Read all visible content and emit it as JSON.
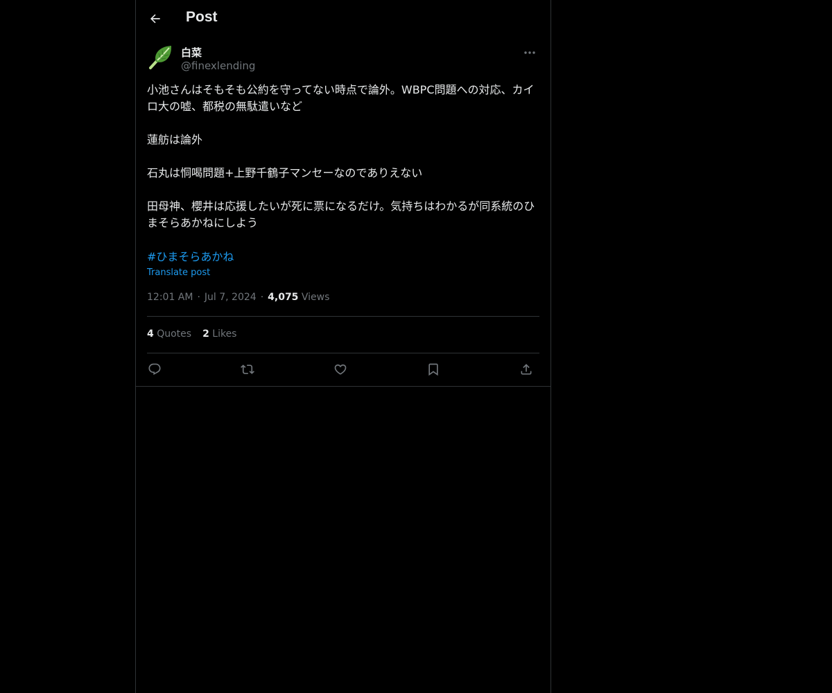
{
  "header": {
    "title": "Post",
    "back_icon": "arrow-left-icon"
  },
  "author": {
    "name": "白菜",
    "handle": "@finexlending",
    "avatar_icon": "leafy-green-icon",
    "more_icon": "more-dots-icon"
  },
  "post": {
    "paragraphs": [
      "小池さんはそもそも公約を守ってない時点で論外。WBPC問題への対応、カイロ大の嘘、都税の無駄遣いなど",
      "蓮舫は論外",
      "石丸は恫喝問題+上野千鶴子マンセーなのでありえない",
      "田母神、櫻井は応援したいが死に票になるだけ。気持ちはわかるが同系統のひまそらあかねにしよう"
    ],
    "hashtag": "#ひまそらあかね",
    "translate_label": "Translate post"
  },
  "meta": {
    "time": "12:01 AM",
    "separator": "·",
    "date": "Jul 7, 2024",
    "views_count": "4,075",
    "views_label": "Views"
  },
  "stats": {
    "quotes_count": "4",
    "quotes_label": "Quotes",
    "likes_count": "2",
    "likes_label": "Likes"
  },
  "actions": {
    "reply_icon": "reply-icon",
    "repost_icon": "repost-icon",
    "like_icon": "heart-icon",
    "bookmark_icon": "bookmark-icon",
    "share_icon": "share-icon"
  },
  "colors": {
    "background": "#000000",
    "text_primary": "#e7e9ea",
    "text_secondary": "#71767b",
    "accent": "#1d9bf0",
    "border": "#2f3336"
  }
}
